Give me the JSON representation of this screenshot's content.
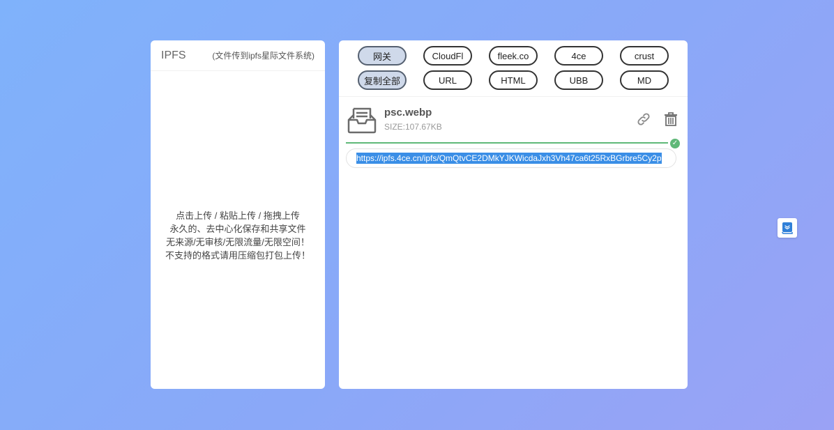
{
  "left_panel": {
    "title": "IPFS",
    "subtitle": "(文件传到ipfs星际文件系统)",
    "drop_lines": [
      "点击上传 / 粘贴上传 / 拖拽上传",
      "永久的、去中心化保存和共享文件",
      "无来源/无审核/无限流量/无限空间！",
      "不支持的格式请用压缩包打包上传！"
    ]
  },
  "right_panel": {
    "gateway_buttons": [
      {
        "label": "网关",
        "active": true
      },
      {
        "label": "CloudFl",
        "active": false
      },
      {
        "label": "fleek.co",
        "active": false
      },
      {
        "label": "4ce",
        "active": false
      },
      {
        "label": "crust",
        "active": false
      }
    ],
    "format_buttons": [
      {
        "label": "复制全部",
        "active": true
      },
      {
        "label": "URL",
        "active": false
      },
      {
        "label": "HTML",
        "active": false
      },
      {
        "label": "UBB",
        "active": false
      },
      {
        "label": "MD",
        "active": false
      }
    ],
    "file": {
      "name": "psc.webp",
      "size": "SIZE:107.67KB",
      "progress": 1.0,
      "url": "https://ipfs.4ce.cn/ipfs/QmQtvCE2DMkYJKWicdaJxh3Vh47ca6t25RxBGrbre5Cy2p"
    }
  },
  "icons": {
    "file": "inbox-tray-icon",
    "link": "link-icon",
    "delete": "trash-icon",
    "done": "check-circle-icon",
    "floating": "book-icon"
  },
  "colors": {
    "progress": "#5fb878",
    "selection": "#3a8ee6",
    "active_button": "#cfd9ea"
  }
}
